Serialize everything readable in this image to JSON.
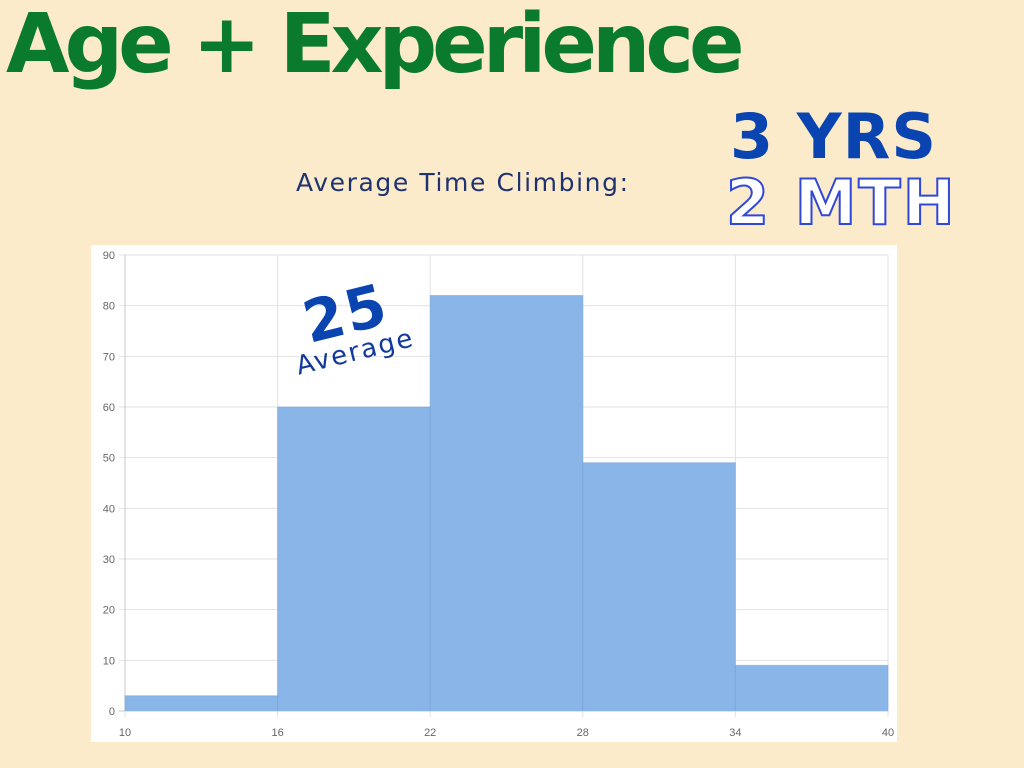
{
  "header": {
    "title": "Age + Experience",
    "subtitle": "Average Time Climbing:",
    "years": "3 YRS",
    "months": "2 MTH"
  },
  "annotation": {
    "value": "25",
    "label": "Average"
  },
  "colors": {
    "background": "#fbebcb",
    "title": "#0a7a2c",
    "accent_blue": "#0a44b0",
    "bar_fill": "#8ab5e8",
    "bar_edge": "#6fa0dc"
  },
  "chart_data": {
    "type": "bar",
    "bins": [
      [
        10,
        16
      ],
      [
        16,
        22
      ],
      [
        22,
        28
      ],
      [
        28,
        34
      ],
      [
        34,
        40
      ]
    ],
    "values": [
      3,
      60,
      82,
      49,
      9
    ],
    "xticks": [
      10,
      16,
      22,
      28,
      34,
      40
    ],
    "yticks": [
      0,
      10,
      20,
      30,
      40,
      50,
      60,
      70,
      80,
      90
    ],
    "xlim": [
      10,
      40
    ],
    "ylim": [
      0,
      90
    ],
    "grid": true,
    "legend": "none"
  }
}
